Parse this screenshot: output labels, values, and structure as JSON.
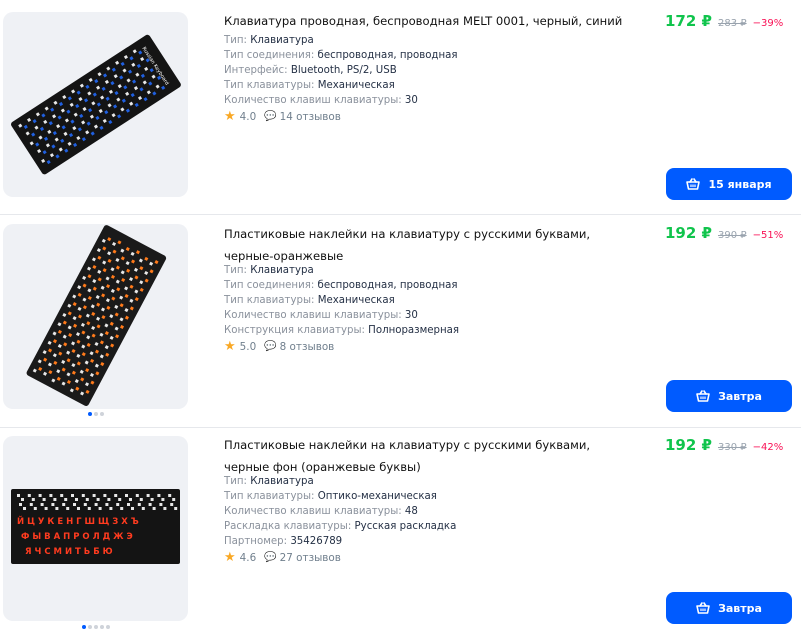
{
  "products": [
    {
      "title": "Клавиатура проводная, беспроводная MELT 0001, черный, синий",
      "specs": [
        {
          "k": "Тип:",
          "v": "Клавиатура"
        },
        {
          "k": "Тип соединения:",
          "v": "беспроводная, проводная"
        },
        {
          "k": "Интерфейс:",
          "v": "Bluetooth, PS/2, USB"
        },
        {
          "k": "Тип клавиатуры:",
          "v": "Механическая"
        },
        {
          "k": "Количество клавиш клавиатуры:",
          "v": "30"
        }
      ],
      "rating": "4.0",
      "reviews": "14 отзывов",
      "price": "172 ₽",
      "old_price": "283 ₽",
      "discount": "−39%",
      "button": "15 января",
      "letter_color": "#1f5fe0",
      "sticker_label": "Russian Keyboard"
    },
    {
      "title": "Пластиковые наклейки на клавиатуру с русскими буквами, черные-оранжевые",
      "specs": [
        {
          "k": "Тип:",
          "v": "Клавиатура"
        },
        {
          "k": "Тип соединения:",
          "v": "беспроводная, проводная"
        },
        {
          "k": "Тип клавиатуры:",
          "v": "Механическая"
        },
        {
          "k": "Количество клавиш клавиатуры:",
          "v": "30"
        },
        {
          "k": "Конструкция клавиатуры:",
          "v": "Полноразмерная"
        }
      ],
      "rating": "5.0",
      "reviews": "8 отзывов",
      "price": "192 ₽",
      "old_price": "390 ₽",
      "discount": "−51%",
      "button": "Завтра",
      "letter_color": "#ff7a1a"
    },
    {
      "title": "Пластиковые наклейки на клавиатуру с русскими буквами, черные фон (оранжевые буквы)",
      "specs": [
        {
          "k": "Тип:",
          "v": "Клавиатура"
        },
        {
          "k": "Тип клавиатуры:",
          "v": "Оптико-механическая"
        },
        {
          "k": "Количество клавиш клавиатуры:",
          "v": "48"
        },
        {
          "k": "Раскладка клавиатуры:",
          "v": "Русская раскладка"
        },
        {
          "k": "Партномер:",
          "v": "35426789"
        }
      ],
      "rating": "4.6",
      "reviews": "27 отзывов",
      "price": "192 ₽",
      "old_price": "330 ₽",
      "discount": "−42%",
      "button": "Завтра",
      "letter_color": "#ff3b1f",
      "sticker_rows": [
        "Й Ц У К Е Н Г Ш Щ З Х Ъ",
        "Ф Ы В А П Р О Л Д Ж Э",
        "Я Ч С М И Т Ь Б Ю"
      ]
    }
  ],
  "icons": {
    "star": "★",
    "reviews": "reviews-bubble-icon",
    "cart": "basket-icon"
  }
}
